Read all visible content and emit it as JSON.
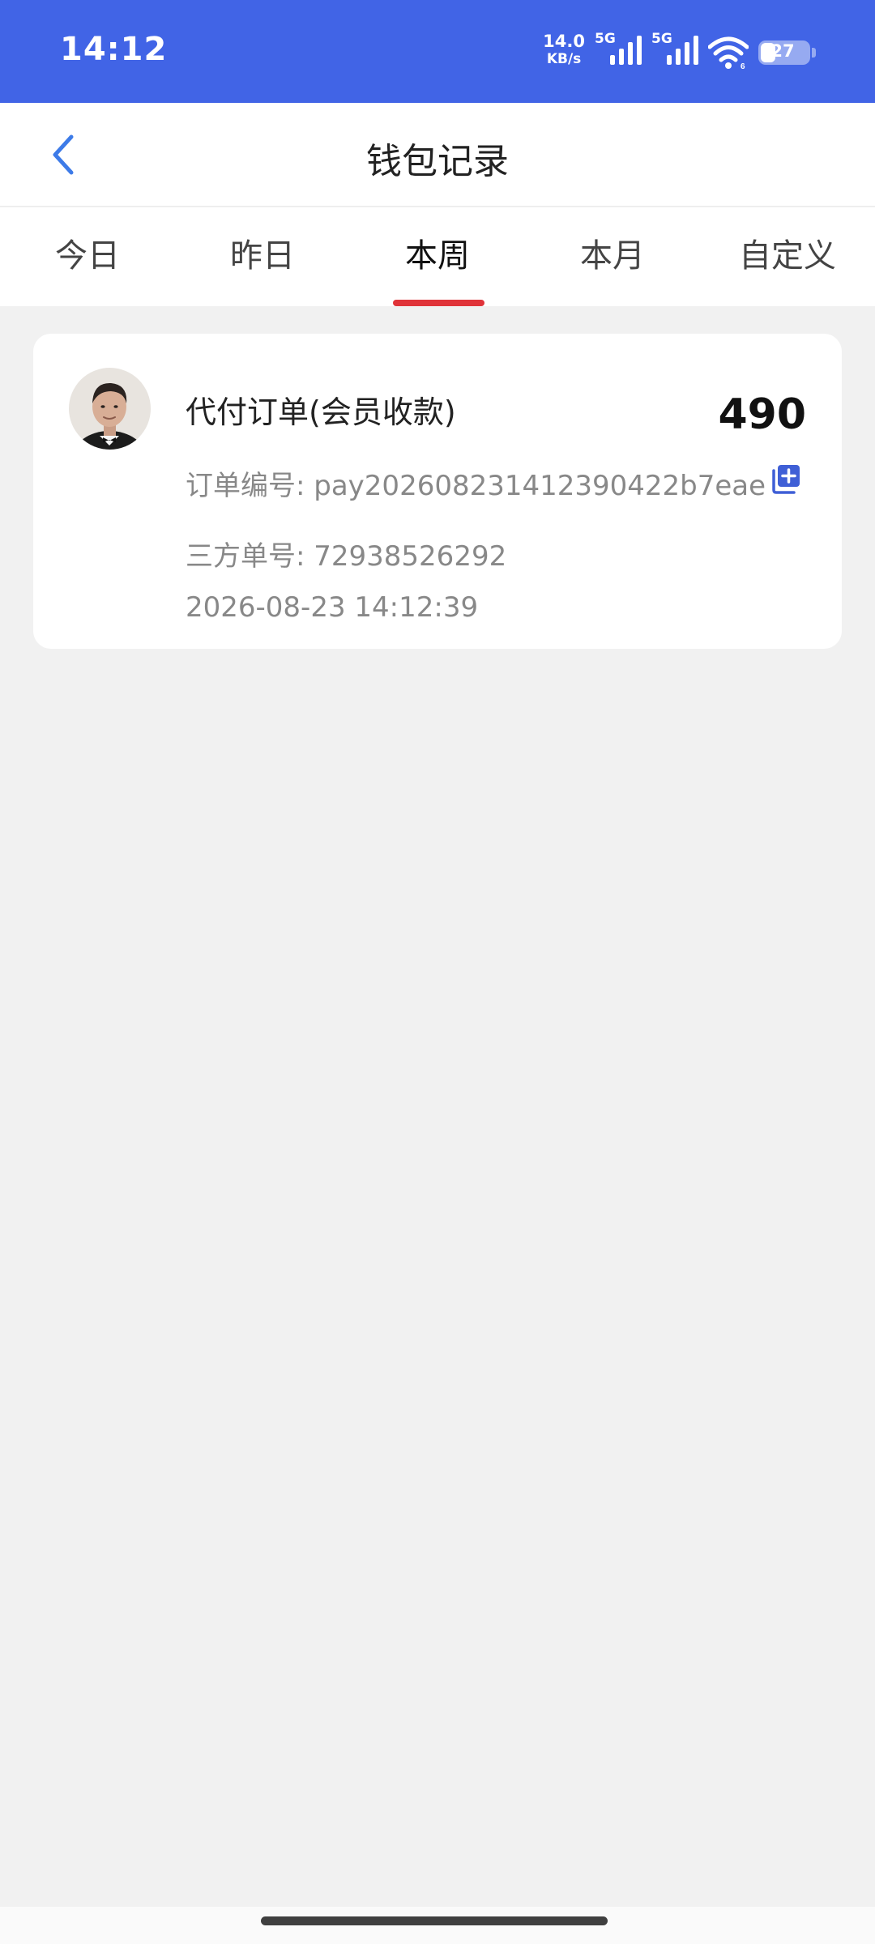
{
  "status_bar": {
    "time": "14:12",
    "net_speed_value": "14.0",
    "net_speed_unit": "KB/s",
    "sim1_tag": "5G",
    "sim2_tag": "5G",
    "battery": "27",
    "wifi_icon": "wifi-icon",
    "color": "#4164e6"
  },
  "nav": {
    "title": "钱包记录",
    "back_icon": "chevron-left-icon"
  },
  "tabs": {
    "items": [
      "今日",
      "昨日",
      "本周",
      "本月",
      "自定义"
    ],
    "active": "本周",
    "indicator_color": "#e03339"
  },
  "records": [
    {
      "title": "代付订单(会员收款)",
      "amount": "490",
      "order_label": "订单编号:",
      "order_no": "pay20260823141239042 2b7eae",
      "order_line": "订单编号: pay202608231412390422b7eae",
      "third_line": "三方单号: 72938526292",
      "time": "2026-08-23 14:12:39",
      "copy_icon": "copy-icon"
    }
  ]
}
